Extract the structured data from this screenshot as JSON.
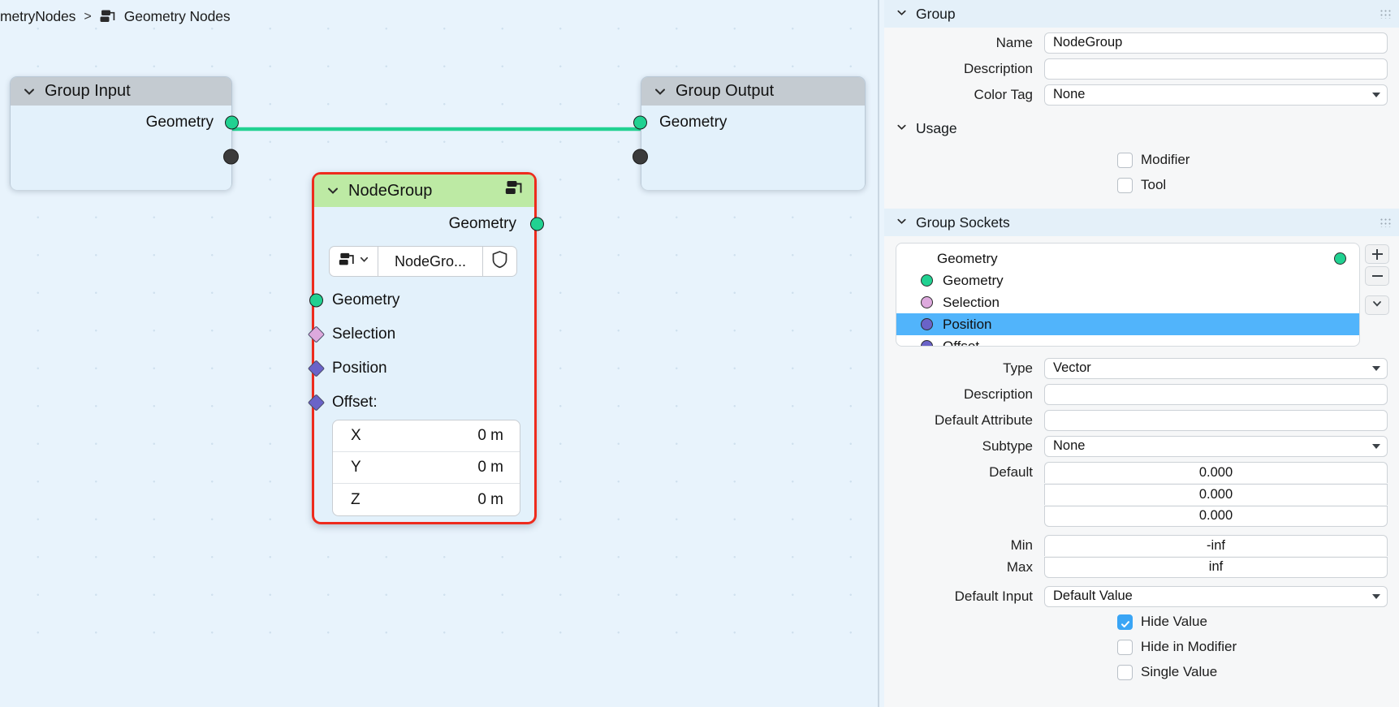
{
  "breadcrumb": {
    "root_label": "metryNodes",
    "separator": ">",
    "tree_icon": "node-tree-icon",
    "current_label": "Geometry Nodes"
  },
  "nodes": {
    "group_input": {
      "title": "Group Input",
      "collapse_icon": "chevron-down-icon",
      "outputs": [
        {
          "label": "Geometry",
          "socket_color": "#21d191",
          "shape": "circle"
        },
        {
          "label": "",
          "socket_color": "#3b3b3b",
          "shape": "circle"
        }
      ]
    },
    "group_output": {
      "title": "Group Output",
      "collapse_icon": "chevron-down-icon",
      "inputs": [
        {
          "label": "Geometry",
          "socket_color": "#21d191",
          "shape": "circle"
        },
        {
          "label": "",
          "socket_color": "#3b3b3b",
          "shape": "circle"
        }
      ]
    },
    "nodegroup": {
      "title": "NodeGroup",
      "collapse_icon": "chevron-down-icon",
      "header_icon": "node-group-icon",
      "outputs": [
        {
          "label": "Geometry",
          "socket_color": "#21d191",
          "shape": "circle"
        }
      ],
      "datablock": {
        "browse_icon": "browse-datablock-icon",
        "browse_arrow_icon": "chevron-down-icon",
        "name": "NodeGro...",
        "shield_icon": "fake-user-shield-icon"
      },
      "inputs": [
        {
          "label": "Geometry",
          "socket_color": "#21d191",
          "shape": "circle"
        },
        {
          "label": "Selection",
          "socket_color": "#dda9dd",
          "shape": "diamond"
        },
        {
          "label": "Position",
          "socket_color": "#6a63c8",
          "shape": "diamond"
        },
        {
          "label": "Offset:",
          "socket_color": "#6a63c8",
          "shape": "diamond"
        }
      ],
      "vector": [
        {
          "axis": "X",
          "value": "0 m"
        },
        {
          "axis": "Y",
          "value": "0 m"
        },
        {
          "axis": "Z",
          "value": "0 m"
        }
      ]
    },
    "link": {
      "color": "#21d191"
    }
  },
  "sidebar": {
    "group_panel": {
      "title": "Group",
      "collapse_icon": "chevron-down-icon",
      "grip_icon": "panel-grip-icon",
      "fields": [
        {
          "label": "Name",
          "value": "NodeGroup",
          "type": "text"
        },
        {
          "label": "Description",
          "value": "",
          "type": "text"
        },
        {
          "label": "Color Tag",
          "value": "None",
          "type": "select"
        }
      ]
    },
    "usage_panel": {
      "title": "Usage",
      "collapse_icon": "chevron-down-icon",
      "checkboxes": [
        {
          "label": "Modifier",
          "checked": false
        },
        {
          "label": "Tool",
          "checked": false
        }
      ]
    },
    "group_sockets_panel": {
      "title": "Group Sockets",
      "collapse_icon": "chevron-down-icon",
      "grip_icon": "panel-grip-icon",
      "list": [
        {
          "label": "Geometry",
          "color": "#21d191",
          "selected": false,
          "is_output_header": true
        },
        {
          "label": "Geometry",
          "color": "#21d191",
          "selected": false
        },
        {
          "label": "Selection",
          "color": "#dda9dd",
          "selected": false
        },
        {
          "label": "Position",
          "color": "#6a63c8",
          "selected": true
        },
        {
          "label": "Offset",
          "color": "#6a63c8",
          "selected": false
        }
      ],
      "buttons": [
        {
          "name": "add-socket-button",
          "glyph": "+"
        },
        {
          "name": "remove-socket-button",
          "glyph": "−"
        },
        {
          "name": "socket-menu-button",
          "glyph": "∨"
        }
      ]
    },
    "socket_properties": {
      "fields": [
        {
          "label": "Type",
          "value": "Vector",
          "type": "select"
        },
        {
          "label": "Description",
          "value": "",
          "type": "text"
        },
        {
          "label": "Default Attribute",
          "value": "",
          "type": "text"
        },
        {
          "label": "Subtype",
          "value": "None",
          "type": "select"
        }
      ],
      "default_label": "Default",
      "default_values": [
        "0.000",
        "0.000",
        "0.000"
      ],
      "min": {
        "label": "Min",
        "value": "-inf"
      },
      "max": {
        "label": "Max",
        "value": "inf"
      },
      "default_input": {
        "label": "Default Input",
        "value": "Default Value"
      },
      "checkboxes": [
        {
          "label": "Hide Value",
          "checked": true
        },
        {
          "label": "Hide in Modifier",
          "checked": false
        },
        {
          "label": "Single Value",
          "checked": false
        }
      ]
    }
  },
  "colors": {
    "geometry_socket": "#21d191",
    "selection_socket": "#dda9dd",
    "vector_socket": "#6a63c8",
    "active_node_outline": "#ee2b1d",
    "node_group_header": "#bdeaa4",
    "selection_highlight": "#51b4fb",
    "canvas_bg": "#e8f3fc"
  }
}
